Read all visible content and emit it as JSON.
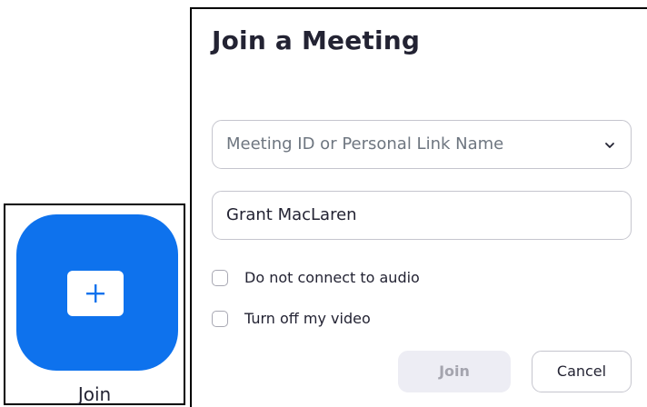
{
  "join_tile": {
    "label": "Join",
    "icon": "plus-icon",
    "color": "#0e72ed"
  },
  "dialog": {
    "title": "Join a Meeting",
    "meeting_id": {
      "value": "",
      "placeholder": "Meeting ID or Personal Link Name",
      "dropdown_icon": "chevron-down-icon"
    },
    "name": {
      "value": "Grant MacLaren"
    },
    "options": [
      {
        "label": "Do not connect to audio",
        "checked": false
      },
      {
        "label": "Turn off my video",
        "checked": false
      }
    ],
    "buttons": {
      "join": {
        "label": "Join",
        "enabled": false
      },
      "cancel": {
        "label": "Cancel"
      }
    }
  }
}
